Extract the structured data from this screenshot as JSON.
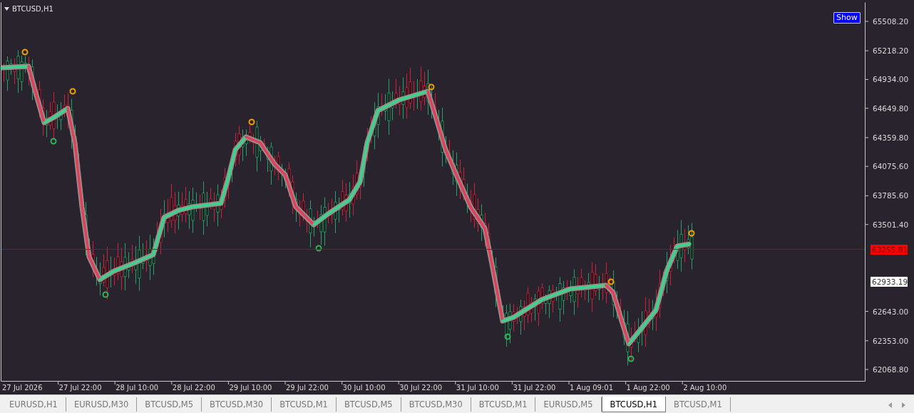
{
  "chart": {
    "title": "BTCUSD,H1",
    "show_button": "Show",
    "price_labels": [
      "65508.20",
      "65218.20",
      "64934.00",
      "64649.80",
      "64359.80",
      "64075.60",
      "63785.60",
      "63501.40",
      "62643.00",
      "62353.00",
      "62068.80"
    ],
    "current_price": "63255.81",
    "line_price": "62933.19",
    "time_labels": [
      "27 Jul 2026",
      "27 Jul 22:00",
      "28 Jul 10:00",
      "28 Jul 22:00",
      "29 Jul 10:00",
      "29 Jul 22:00",
      "30 Jul 10:00",
      "30 Jul 22:00",
      "31 Jul 10:00",
      "31 Jul 22:00",
      "1 Aug 09:01",
      "1 Aug 22:00",
      "2 Aug 10:00"
    ]
  },
  "tabs": [
    {
      "label": "EURUSD,H1",
      "selected": false
    },
    {
      "label": "EURUSD,M30",
      "selected": false
    },
    {
      "label": "BTCUSD,M5",
      "selected": false
    },
    {
      "label": "BTCUSD,M30",
      "selected": false
    },
    {
      "label": "BTCUSD,M1",
      "selected": false
    },
    {
      "label": "BTCUSD,M5",
      "selected": false
    },
    {
      "label": "BTCUSD,M30",
      "selected": false
    },
    {
      "label": "BTCUSD,M1",
      "selected": false
    },
    {
      "label": "EURUSD,M5",
      "selected": false
    },
    {
      "label": "BTCUSD,H1",
      "selected": true
    },
    {
      "label": "BTCUSD,M1",
      "selected": false
    }
  ]
}
